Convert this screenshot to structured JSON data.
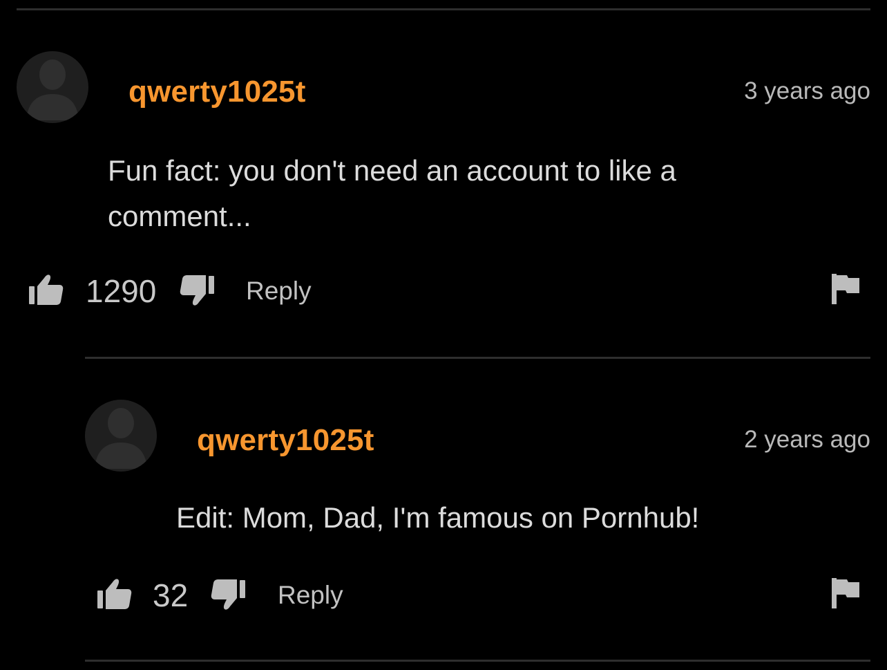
{
  "comments": [
    {
      "username": "qwerty1025t",
      "timestamp": "3 years ago",
      "text": "Fun fact: you don't need an account to like a comment...",
      "likes": "1290",
      "reply_label": "Reply",
      "avatar_icon": "default-avatar-icon",
      "like_icon": "thumbs-up-icon",
      "dislike_icon": "thumbs-down-icon",
      "flag_icon": "flag-icon"
    },
    {
      "username": "qwerty1025t",
      "timestamp": "2 years ago",
      "text": "Edit: Mom, Dad, I'm famous on Pornhub!",
      "likes": "32",
      "reply_label": "Reply",
      "avatar_icon": "default-avatar-icon",
      "like_icon": "thumbs-up-icon",
      "dislike_icon": "thumbs-down-icon",
      "flag_icon": "flag-icon"
    }
  ],
  "colors": {
    "background": "#000000",
    "username": "#f7962f",
    "divider": "#2e2e2e",
    "icon": "#bdbdbd"
  }
}
